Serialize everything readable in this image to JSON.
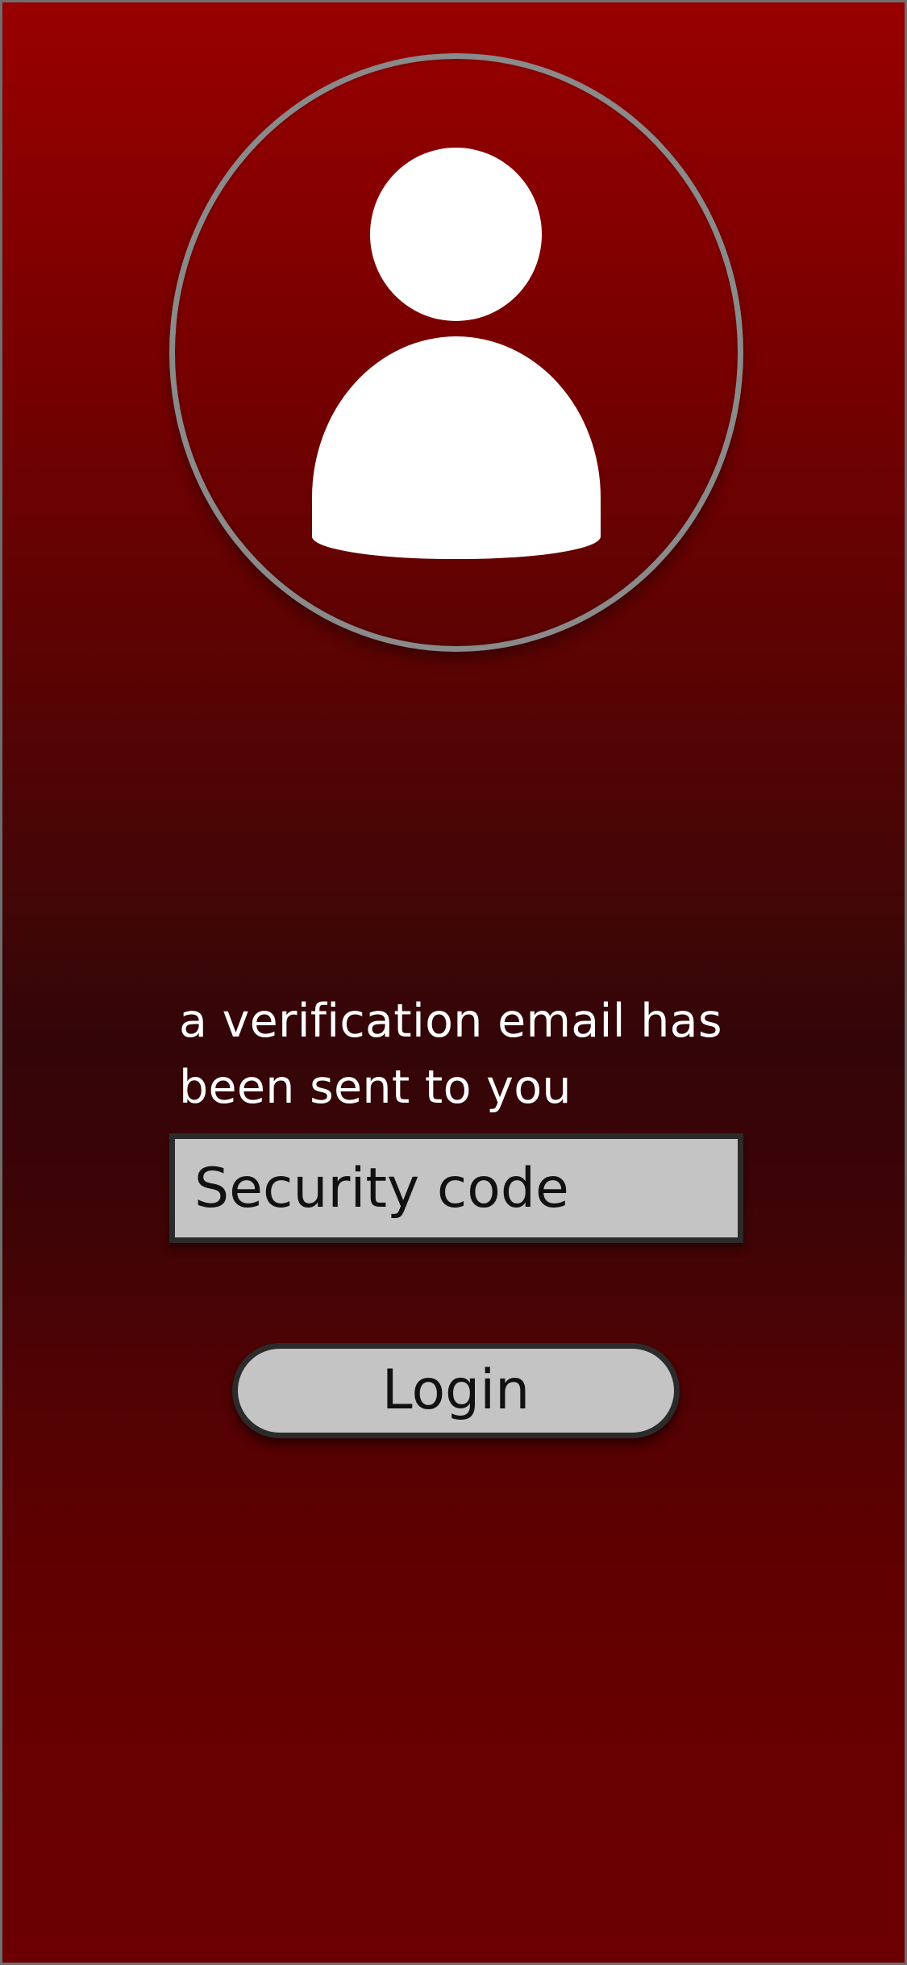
{
  "avatar": {
    "icon": "user-profile-icon"
  },
  "message": {
    "text": "a verification email has been sent to you"
  },
  "security_code": {
    "placeholder": "Security code",
    "value": ""
  },
  "login": {
    "label": "Login"
  },
  "colors": {
    "background_top": "#990000",
    "background_middle": "#330508",
    "background_bottom": "#6c0000",
    "field_fill": "#c4c4c4",
    "field_border": "#2b2b2b",
    "avatar_ring": "#8a8a8a",
    "text_light": "#ffffff",
    "text_dark": "#111111"
  }
}
